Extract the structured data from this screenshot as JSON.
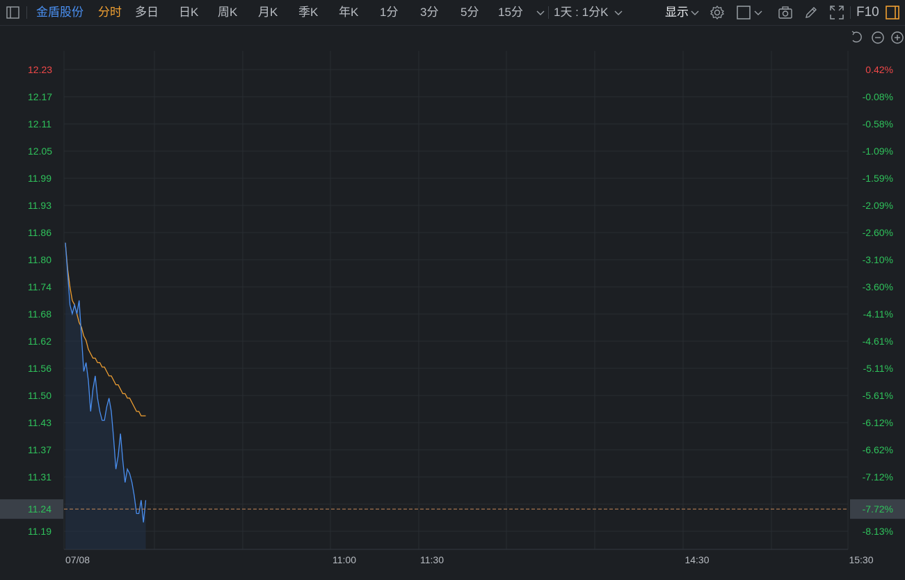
{
  "toolbar": {
    "stock_name": "金盾股份",
    "tabs": [
      {
        "label": "分时",
        "active": true
      },
      {
        "label": "多日",
        "active": false
      },
      {
        "label": "日K",
        "active": false
      },
      {
        "label": "周K",
        "active": false
      },
      {
        "label": "月K",
        "active": false
      },
      {
        "label": "季K",
        "active": false
      },
      {
        "label": "年K",
        "active": false
      },
      {
        "label": "1分",
        "active": false
      },
      {
        "label": "3分",
        "active": false
      },
      {
        "label": "5分",
        "active": false
      },
      {
        "label": "15分",
        "active": false
      }
    ],
    "period_select": "1天 : 1分K",
    "display_label": "显示",
    "f10_label": "F10",
    "icons": [
      "sidebar-toggle-icon",
      "chevron-down-icon",
      "gear-icon",
      "square-icon",
      "camera-icon",
      "pencil-icon",
      "fullscreen-icon",
      "panel-icon"
    ]
  },
  "chart_controls": {
    "icons": [
      "undo-icon",
      "zoom-out-icon",
      "zoom-in-icon"
    ]
  },
  "colors": {
    "background": "#1c1f23",
    "price_line": "#4a8ff0",
    "avg_line": "#f0a032",
    "up": "#f04848",
    "down": "#2fc25b",
    "reference_line": "#c88a5a",
    "active_tab": "#f0a032"
  },
  "chart_data": {
    "type": "line",
    "y_left_ticks": [
      "12.23",
      "12.17",
      "12.11",
      "12.05",
      "11.99",
      "11.93",
      "11.86",
      "11.80",
      "11.74",
      "11.68",
      "11.62",
      "11.56",
      "11.50",
      "11.43",
      "11.37",
      "11.31",
      "11.24",
      "11.19"
    ],
    "y_right_ticks": [
      "0.42%",
      "-0.08%",
      "-0.58%",
      "-1.09%",
      "-1.59%",
      "-2.09%",
      "-2.60%",
      "-3.10%",
      "-3.60%",
      "-4.11%",
      "-4.61%",
      "-5.11%",
      "-5.61%",
      "-6.12%",
      "-6.62%",
      "-7.12%",
      "-7.72%",
      "-8.13%"
    ],
    "x_ticks": [
      "07/08",
      "11:00",
      "11:30",
      "14:30",
      "15:30"
    ],
    "ylim": [
      11.19,
      12.23
    ],
    "current_price": "11.24",
    "current_pct": "-7.72%",
    "series": [
      {
        "values": [
          11.84,
          11.77,
          11.7,
          11.68,
          11.7,
          11.68,
          11.71,
          11.63,
          11.55,
          11.57,
          11.53,
          11.46,
          11.51,
          11.54,
          11.49,
          11.46,
          11.44,
          11.44,
          11.47,
          11.49,
          11.46,
          11.4,
          11.33,
          11.36,
          11.41,
          11.35,
          11.3,
          11.33,
          11.32,
          11.3,
          11.27,
          11.23,
          11.23,
          11.26,
          11.21,
          11.26
        ]
      },
      {
        "values": [
          11.84,
          11.78,
          11.74,
          11.71,
          11.7,
          11.68,
          11.66,
          11.65,
          11.63,
          11.62,
          11.6,
          11.59,
          11.58,
          11.58,
          11.57,
          11.57,
          11.56,
          11.56,
          11.55,
          11.54,
          11.54,
          11.53,
          11.52,
          11.52,
          11.51,
          11.5,
          11.5,
          11.49,
          11.49,
          11.48,
          11.47,
          11.46,
          11.46,
          11.45,
          11.45,
          11.45
        ]
      }
    ]
  }
}
